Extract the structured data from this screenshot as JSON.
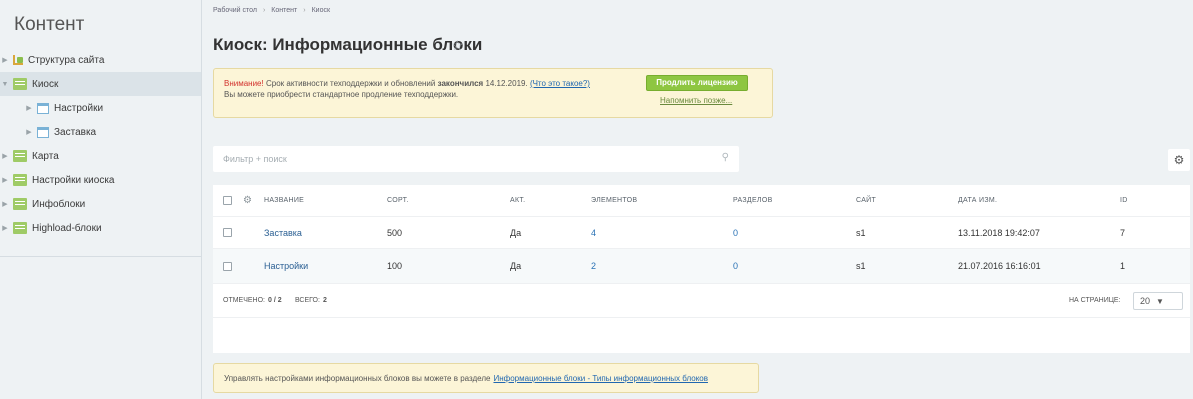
{
  "sidebar": {
    "title": "Контент",
    "items": [
      {
        "label": "Структура сайта"
      },
      {
        "label": "Киоск"
      },
      {
        "label": "Настройки"
      },
      {
        "label": "Заставка"
      },
      {
        "label": "Карта"
      },
      {
        "label": "Настройки киоска"
      },
      {
        "label": "Инфоблоки"
      },
      {
        "label": "Highload-блоки"
      }
    ]
  },
  "breadcrumb": [
    "Рабочий стол",
    "Контент",
    "Киоск"
  ],
  "page_title": "Киоск: Информационные блоки",
  "notice": {
    "warning_word": "Внимание!",
    "text_before": "Срок активности техподдержки и обновлений",
    "text_bold": "закончился",
    "date": "14.12.2019.",
    "link": "(Что это такое?)",
    "line2": "Вы можете приобрести стандартное продление техподдержки.",
    "button": "Продлить лицензию",
    "remind": "Напомнить позже..."
  },
  "filter": {
    "placeholder": "Фильтр + поиск"
  },
  "table": {
    "columns": [
      "НАЗВАНИЕ",
      "СОРТ.",
      "АКТ.",
      "ЭЛЕМЕНТОВ",
      "РАЗДЕЛОВ",
      "САЙТ",
      "ДАТА ИЗМ.",
      "ID"
    ],
    "rows": [
      {
        "name": "Заставка",
        "sort": "500",
        "active": "Да",
        "elements": "4",
        "sections": "0",
        "site": "s1",
        "date": "13.11.2018 19:42:07",
        "id": "7"
      },
      {
        "name": "Настройки",
        "sort": "100",
        "active": "Да",
        "elements": "2",
        "sections": "0",
        "site": "s1",
        "date": "21.07.2016 16:16:01",
        "id": "1"
      }
    ],
    "footer": {
      "checked_label": "ОТМЕЧЕНО:",
      "checked_value": "0 / 2",
      "total_label": "ВСЕГО:",
      "total_value": "2",
      "per_page_label": "НА СТРАНИЦЕ:",
      "per_page_value": "20"
    }
  },
  "bottom_notice": {
    "text": "Управлять настройками информационных блоков вы можете в разделе",
    "link": "Информационные блоки - Типы информационных блоков"
  }
}
